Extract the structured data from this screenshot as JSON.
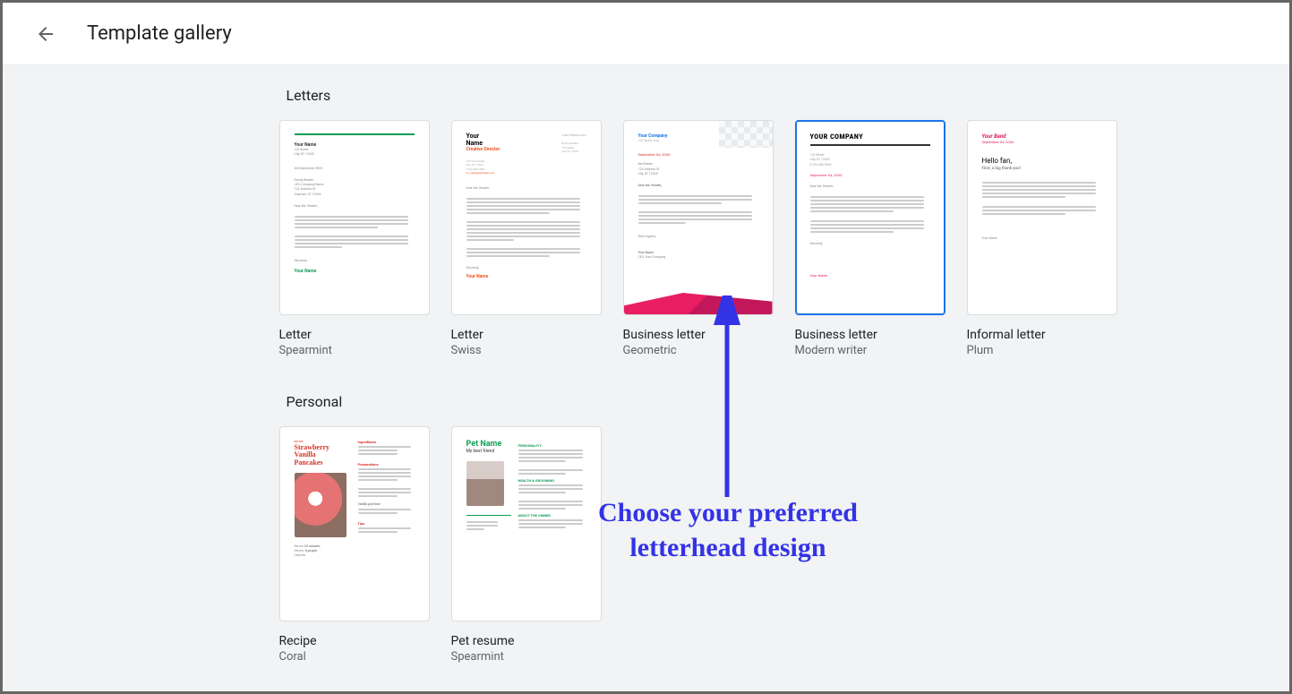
{
  "header": {
    "title": "Template gallery"
  },
  "sections": {
    "letters": {
      "title": "Letters",
      "templates": [
        {
          "name": "Letter",
          "subtitle": "Spearmint"
        },
        {
          "name": "Letter",
          "subtitle": "Swiss"
        },
        {
          "name": "Business letter",
          "subtitle": "Geometric"
        },
        {
          "name": "Business letter",
          "subtitle": "Modern writer"
        },
        {
          "name": "Informal letter",
          "subtitle": "Plum"
        }
      ]
    },
    "personal": {
      "title": "Personal",
      "templates": [
        {
          "name": "Recipe",
          "subtitle": "Coral"
        },
        {
          "name": "Pet resume",
          "subtitle": "Spearmint"
        }
      ]
    }
  },
  "thumbnail_text": {
    "spearmint": {
      "your_name": "Your Name",
      "footer": "Your Name"
    },
    "swiss": {
      "line1": "Your",
      "line2": "Name",
      "role": "Creative Director",
      "footer": "Your Name"
    },
    "geometric": {
      "company": "Your Company",
      "date": "September 04, 20XX",
      "sig": "Your Name"
    },
    "modern": {
      "company": "YOUR COMPANY",
      "date": "September 04, 20XX",
      "footer": "Your Name"
    },
    "plum": {
      "brand": "Your Band",
      "date": "September 04, 20XX",
      "hello": "Hello fan,",
      "sub": "First, a big thank you!"
    },
    "recipe": {
      "label": "RECIPE",
      "title1": "Strawberry",
      "title2": "Vanilla",
      "title3": "Pancakes",
      "h1": "Ingredients",
      "h2": "Preparations",
      "h3": "Tips"
    },
    "pet": {
      "name": "Pet Name",
      "sub": "My best friend",
      "h1": "PERSONALITY",
      "h2": "HEALTH & GROOMING",
      "h3": "ABOUT THE OWNER"
    }
  },
  "annotation": {
    "text": "Choose your preferred letterhead design"
  }
}
